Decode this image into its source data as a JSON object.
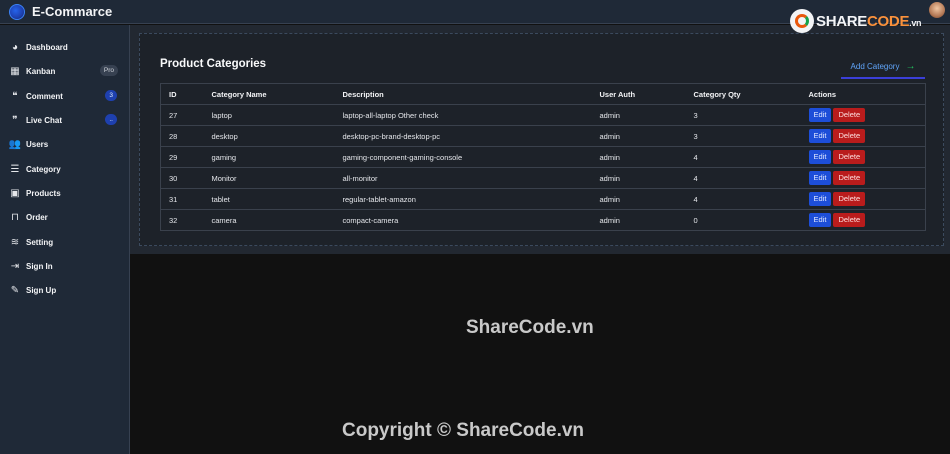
{
  "app": {
    "title": "E-Commarce"
  },
  "sidebar": {
    "items": [
      {
        "label": "Dashboard",
        "icon": "dashboard-icon",
        "glyph": "◕"
      },
      {
        "label": "Kanban",
        "icon": "grid-icon",
        "glyph": "▦",
        "badge": "Pro"
      },
      {
        "label": "Comment",
        "icon": "comment-icon",
        "glyph": "❝",
        "badge": "3"
      },
      {
        "label": "Live Chat",
        "icon": "chat-icon",
        "glyph": "❞",
        "badge": ".."
      },
      {
        "label": "Users",
        "icon": "users-icon",
        "glyph": "👥"
      },
      {
        "label": "Category",
        "icon": "menu-icon",
        "glyph": "☰"
      },
      {
        "label": "Products",
        "icon": "bag-icon",
        "glyph": "▣"
      },
      {
        "label": "Order",
        "icon": "bed-icon",
        "glyph": "⊓"
      },
      {
        "label": "Setting",
        "icon": "sliders-icon",
        "glyph": "≋"
      },
      {
        "label": "Sign In",
        "icon": "sign-in-icon",
        "glyph": "⇥"
      },
      {
        "label": "Sign Up",
        "icon": "sign-up-icon",
        "glyph": "✎"
      }
    ]
  },
  "main": {
    "title": "Product Categories",
    "add_button": "Add Category",
    "columns": [
      "ID",
      "Category Name",
      "Description",
      "User Auth",
      "Category Qty",
      "Actions"
    ],
    "rows": [
      [
        "27",
        "laptop",
        "laptop-all-laptop Other check",
        "admin",
        "3"
      ],
      [
        "28",
        "desktop",
        "desktop-pc-brand-desktop-pc",
        "admin",
        "3"
      ],
      [
        "29",
        "gaming",
        "gaming-component-gaming-console",
        "admin",
        "4"
      ],
      [
        "30",
        "Monitor",
        "all-monitor",
        "admin",
        "4"
      ],
      [
        "31",
        "tablet",
        "regular-tablet-amazon",
        "admin",
        "4"
      ],
      [
        "32",
        "camera",
        "compact-camera",
        "admin",
        "0"
      ]
    ],
    "edit_label": "Edit",
    "delete_label": "Delete"
  },
  "watermark": {
    "top_share": "SHARE",
    "top_code": "CODE",
    "top_domain": ".vn",
    "center": "ShareCode.vn",
    "bottom": "Copyright © ShareCode.vn"
  },
  "colors": {
    "accent": "#1d4ed8",
    "danger": "#b91c1c",
    "sidebar": "#1f2937",
    "success": "#22c55e"
  }
}
